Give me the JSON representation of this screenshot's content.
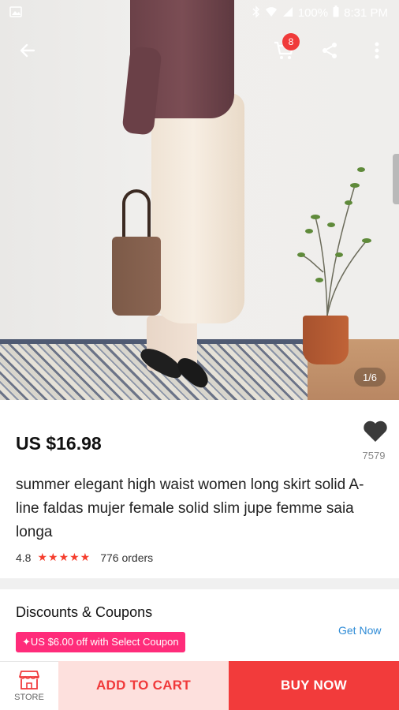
{
  "status_bar": {
    "battery": "100%",
    "time": "8:31 PM"
  },
  "toolbar": {
    "cart_count": "8"
  },
  "gallery": {
    "counter": "1/6"
  },
  "product": {
    "price": "US $16.98",
    "wishlist_count": "7579",
    "title": "summer elegant high waist women long skirt solid A-line faldas mujer female solid slim jupe femme saia longa",
    "rating": "4.8",
    "stars": "★★★★★",
    "orders": "776 orders"
  },
  "coupons": {
    "title": "Discounts & Coupons",
    "tag": "✦US $6.00 off with Select Coupon",
    "action": "Get Now"
  },
  "bottom_bar": {
    "store_label": "STORE",
    "add_to_cart": "ADD TO CART",
    "buy_now": "BUY NOW"
  },
  "colors": {
    "accent_red": "#f23b3b",
    "add_cart_bg": "#fde0dd",
    "coupon_pink": "#ff2c7a",
    "link_blue": "#2e8bd6",
    "star_red": "#f53d2d"
  }
}
